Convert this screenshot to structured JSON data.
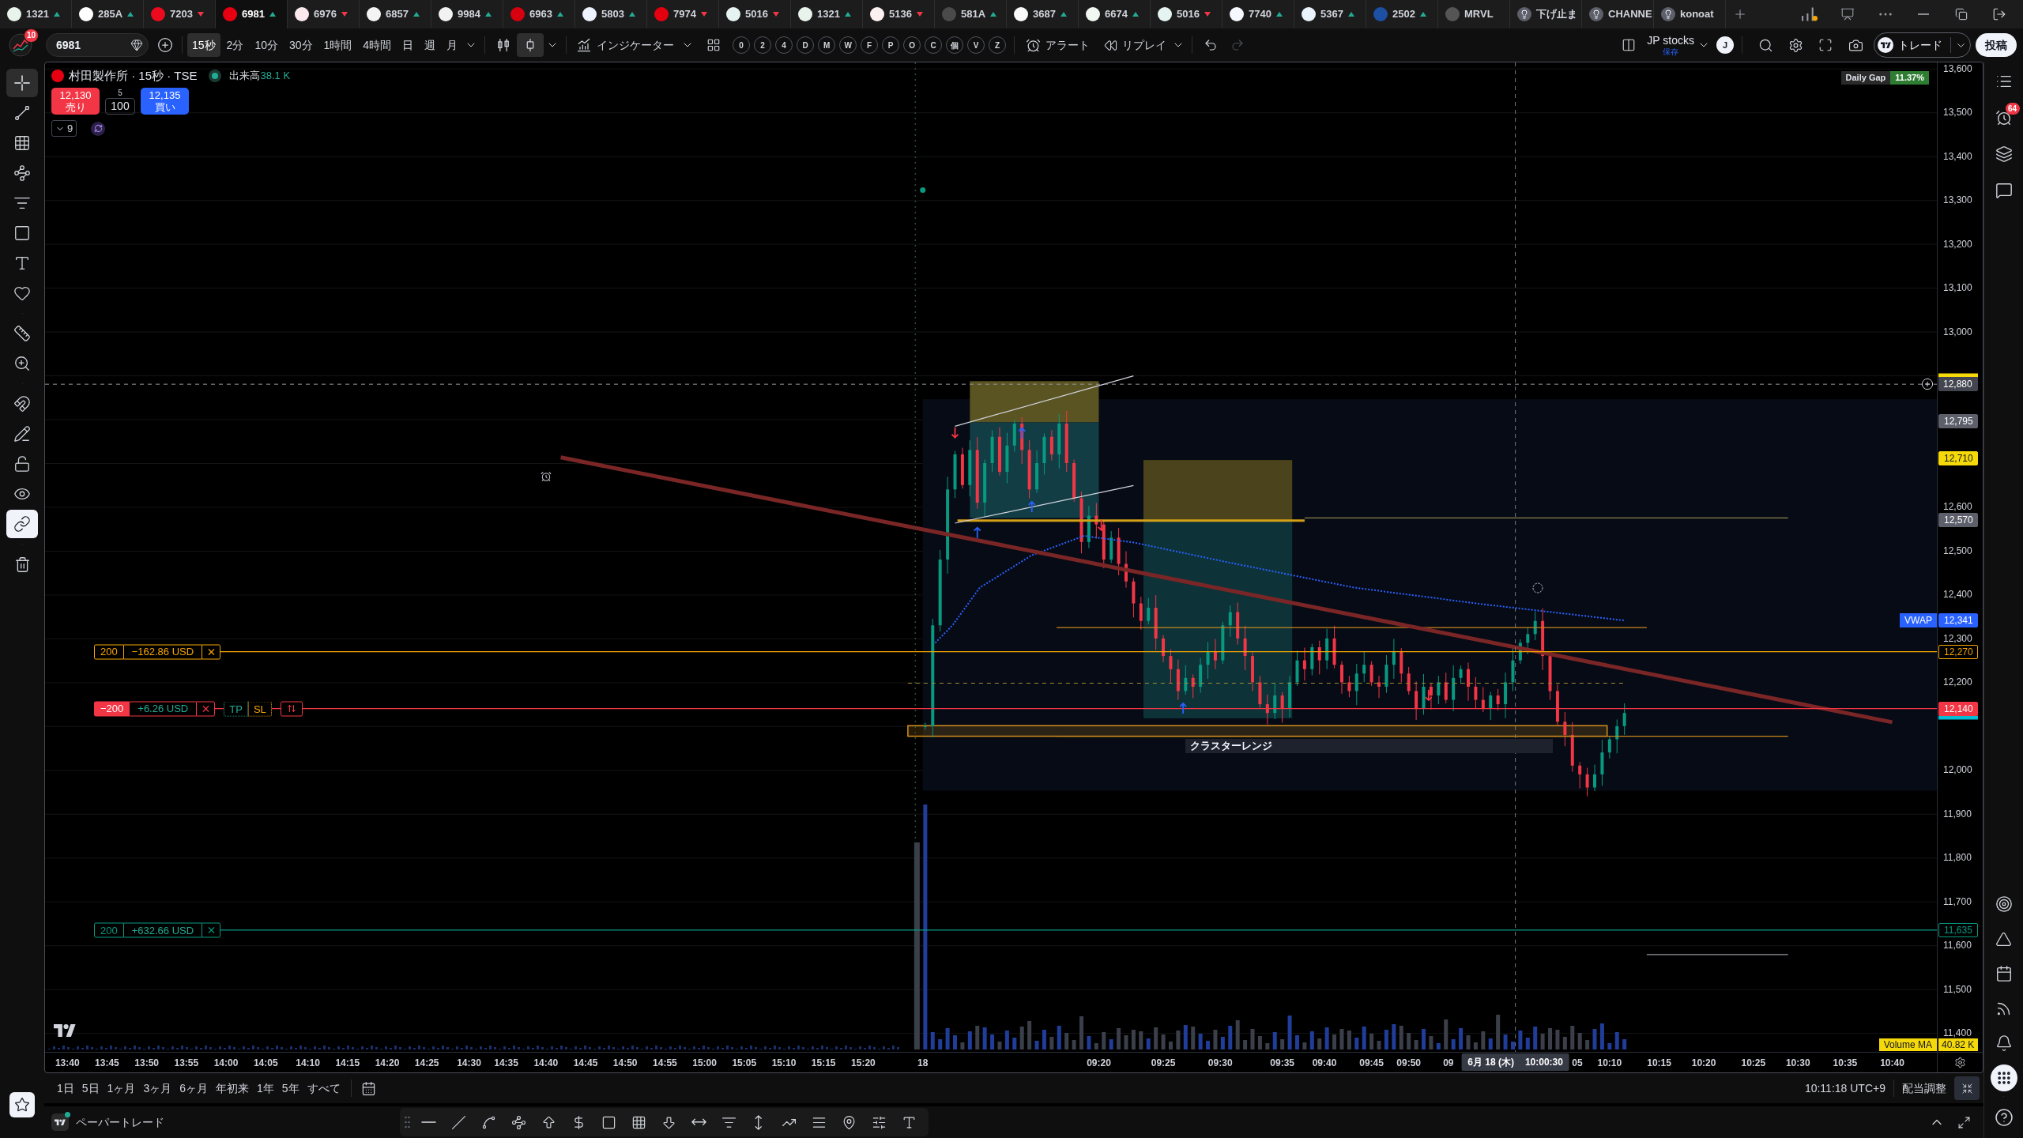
{
  "tabs": [
    {
      "kind": "symbol",
      "label": "1321",
      "color": "#e8f3ec",
      "up": true,
      "selected": false
    },
    {
      "kind": "symbol",
      "label": "285A",
      "color": "#ffffff",
      "up": true,
      "selected": false
    },
    {
      "kind": "symbol",
      "label": "7203",
      "color": "#eb0a1e",
      "up": false,
      "selected": false
    },
    {
      "kind": "symbol",
      "label": "6981",
      "color": "#e60012",
      "up": true,
      "selected": true
    },
    {
      "kind": "symbol",
      "label": "6976",
      "color": "#fbe9ee",
      "up": false,
      "selected": false
    },
    {
      "kind": "symbol",
      "label": "6857",
      "color": "#f4f4f4",
      "up": true,
      "selected": false
    },
    {
      "kind": "symbol",
      "label": "9984",
      "color": "#f2f2f2",
      "up": true,
      "selected": false
    },
    {
      "kind": "symbol",
      "label": "6963",
      "color": "#d7000f",
      "up": true,
      "selected": false
    },
    {
      "kind": "symbol",
      "label": "5803",
      "color": "#eef3ff",
      "up": true,
      "selected": false
    },
    {
      "kind": "symbol",
      "label": "7974",
      "color": "#e4000f",
      "up": false,
      "selected": false
    },
    {
      "kind": "symbol",
      "label": "5016",
      "color": "#e6f4f1",
      "up": false,
      "selected": false
    },
    {
      "kind": "symbol",
      "label": "1321",
      "color": "#e8f3ec",
      "up": true,
      "selected": false
    },
    {
      "kind": "symbol",
      "label": "5136",
      "color": "#fdf0f0",
      "up": false,
      "selected": false
    },
    {
      "kind": "symbol",
      "label": "581A",
      "color": "#4a4a4a",
      "up": true,
      "selected": false
    },
    {
      "kind": "symbol",
      "label": "3687",
      "color": "#fafafa",
      "up": true,
      "selected": false
    },
    {
      "kind": "symbol",
      "label": "6674",
      "color": "#f1f8f1",
      "up": true,
      "selected": false
    },
    {
      "kind": "symbol",
      "label": "5016",
      "color": "#e6f4f1",
      "up": false,
      "selected": false
    },
    {
      "kind": "symbol",
      "label": "7740",
      "color": "#f5f8ff",
      "up": true,
      "selected": false
    },
    {
      "kind": "symbol",
      "label": "5367",
      "color": "#eaf2fb",
      "up": true,
      "selected": false
    },
    {
      "kind": "symbol",
      "label": "2502",
      "color": "#1d4fa3",
      "up": true,
      "selected": false
    },
    {
      "kind": "symbol",
      "label": "MRVL",
      "color": "#555555",
      "selected": false
    },
    {
      "kind": "idea",
      "label": "下げ止ま",
      "selected": false
    },
    {
      "kind": "idea",
      "label": "CHANNE",
      "selected": false
    },
    {
      "kind": "idea",
      "label": "konoat",
      "selected": false
    }
  ],
  "toolbar": {
    "notifications": "10",
    "symbol": "6981",
    "intervals": [
      {
        "label": "15秒",
        "selected": true
      },
      {
        "label": "2分",
        "selected": false
      },
      {
        "label": "10分",
        "selected": false
      },
      {
        "label": "30分",
        "selected": false
      },
      {
        "label": "1時間",
        "selected": false
      },
      {
        "label": "4時間",
        "selected": false
      },
      {
        "label": "日",
        "selected": false
      },
      {
        "label": "週",
        "selected": false
      },
      {
        "label": "月",
        "selected": false
      }
    ],
    "chart_types": [
      {
        "kind": "bars",
        "selected": false
      },
      {
        "kind": "candles",
        "selected": true
      }
    ],
    "indicators": "インジケーター",
    "quick_buttons": [
      "0",
      "2",
      "4",
      "D",
      "M",
      "W",
      "F",
      "P",
      "O",
      "C",
      "個",
      "V",
      "Z"
    ],
    "alert": "アラート",
    "replay": "リプレイ",
    "undo_disabled": false,
    "redo_disabled": true,
    "layout_name": "JP stocks",
    "layout_status": "保存",
    "user_initial": "J",
    "trade": "トレード",
    "publish": "投稿"
  },
  "left_toolbar": {
    "tools": [
      {
        "kind": "crosshair",
        "selected": true
      },
      {
        "kind": "trend_line",
        "selected": false
      },
      {
        "kind": "fib",
        "selected": false
      },
      {
        "kind": "pattern",
        "selected": false
      },
      {
        "kind": "forecast",
        "selected": false
      },
      {
        "kind": "shapes",
        "selected": false
      },
      {
        "kind": "text",
        "selected": false
      },
      {
        "kind": "icons",
        "selected": false
      }
    ],
    "measure_tools": [
      {
        "kind": "ruler",
        "selected": false
      },
      {
        "kind": "zoom",
        "selected": false
      }
    ],
    "toggles": [
      {
        "kind": "magnet",
        "on": false
      },
      {
        "kind": "drawing_mode",
        "on": false
      },
      {
        "kind": "lock",
        "on": false
      },
      {
        "kind": "visibility",
        "on": false
      },
      {
        "kind": "sync",
        "on": true
      }
    ],
    "favorites_on": true
  },
  "legend": {
    "title": "村田製作所 · 15秒 · TSE",
    "market_open": true,
    "volume_label": "出来高",
    "volume_value": "38.1 K",
    "sell_price": "12,130",
    "sell_label": "売り",
    "spread": "5",
    "quantity": "100",
    "buy_price": "12,135",
    "buy_label": "買い",
    "indicator_count": "9"
  },
  "daily_gap": {
    "label": "Daily Gap",
    "value": "11.37%"
  },
  "volume_ma": {
    "label": "Volume MA",
    "value": "40.82 K"
  },
  "price_axis": [
    "13,600",
    "13,500",
    "13,400",
    "13,300",
    "13,200",
    "13,100",
    "13,000",
    "12,600",
    "12,500",
    "12,400",
    "12,300",
    "12,200",
    "12,000",
    "11,900",
    "11,800",
    "11,700",
    "11,600",
    "11,500",
    "11,400"
  ],
  "time_axis": {
    "labels": [
      "13:40",
      "13:45",
      "13:50",
      "13:55",
      "14:00",
      "14:05",
      "14:10",
      "14:15",
      "14:20",
      "14:25",
      "14:30",
      "14:35",
      "14:40",
      "14:45",
      "14:50",
      "14:55",
      "15:00",
      "15:05",
      "15:10",
      "15:15",
      "15:20",
      "18",
      "09:20",
      "09:25",
      "09:30",
      "09:35",
      "09:40",
      "09:45",
      "09:50",
      "09",
      "05",
      "10:10",
      "10:15",
      "10:20",
      "10:25",
      "10:30",
      "10:35",
      "10:40"
    ],
    "crosshair_date": "6月 18 (木)",
    "crosshair_time": "10:00:30"
  },
  "price_scale": {
    "crosshair_price": "12,880",
    "tags": [
      {
        "label": "12,795",
        "color": "#5d606b"
      },
      {
        "label": "12,710",
        "color": "#f5d90a"
      },
      {
        "label": "12,570",
        "color": "#5d606b"
      },
      {
        "label": "12,341",
        "color": "#2962ff",
        "indicator": "VWAP"
      },
      {
        "label": "12,270",
        "color": "#f7a600"
      },
      {
        "label": "12,140",
        "color": "#f23645"
      },
      {
        "label": "11,635",
        "color": "#089981"
      }
    ]
  },
  "orders": [
    {
      "kind": "order",
      "quantity": "200",
      "pnl": "−162.86 USD",
      "color": "#f7a600",
      "in_profit": false
    },
    {
      "kind": "position",
      "quantity": "−200",
      "pnl": "+6.26 USD",
      "color": "#f23645",
      "in_profit": true,
      "take_profit": "TP",
      "stop_loss": "SL"
    },
    {
      "kind": "order",
      "quantity": "200",
      "pnl": "+632.66 USD",
      "color": "#089981",
      "in_profit": true
    }
  ],
  "range_label": "クラスターレンジ",
  "chart_footer": {
    "ranges": [
      "1日",
      "5日",
      "1ヶ月",
      "3ヶ月",
      "6ヶ月",
      "年初来",
      "1年",
      "5年",
      "すべて"
    ],
    "clock": "10:11:18 UTC+9",
    "adjustment": "配当調整"
  },
  "paper_trading": {
    "label": "ペーパートレード",
    "connected": true
  },
  "right_sidebar": {
    "alerts_badge": "64"
  }
}
